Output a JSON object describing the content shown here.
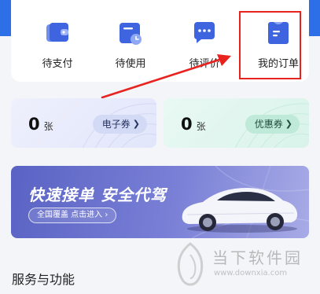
{
  "orders": {
    "items": [
      {
        "label": "待支付",
        "icon": "wallet-icon"
      },
      {
        "label": "待使用",
        "icon": "clock-card-icon"
      },
      {
        "label": "待评价",
        "icon": "chat-dots-icon"
      },
      {
        "label": "我的订单",
        "icon": "order-doc-icon"
      }
    ]
  },
  "coupons": {
    "electronic": {
      "count": "0",
      "unit": "张",
      "button": "电子券"
    },
    "discount": {
      "count": "0",
      "unit": "张",
      "button": "优惠券"
    }
  },
  "banner": {
    "title": "快速接单  安全代驾",
    "subtitle": "全国覆盖 点击进入 ›"
  },
  "section": {
    "title": "服务与功能"
  },
  "watermark": {
    "name": "当下软件园",
    "url": "www.downxia.com"
  },
  "colors": {
    "accent": "#3f64e0",
    "annotation": "#e8231f"
  }
}
